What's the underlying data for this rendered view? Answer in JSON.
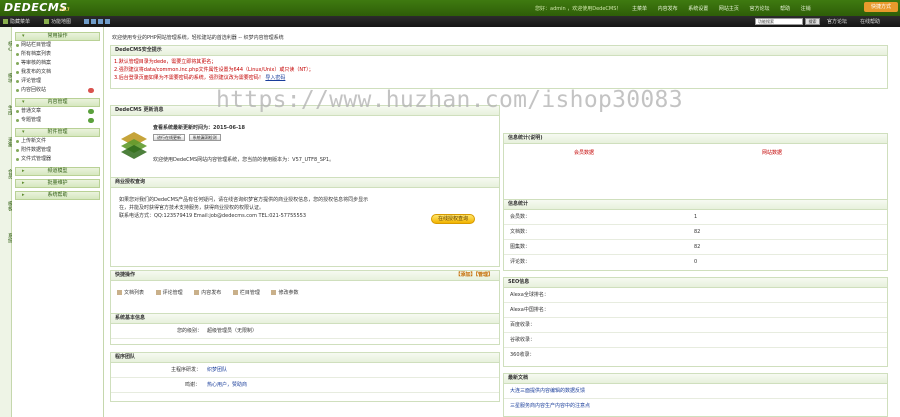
{
  "app": {
    "logo": "DEDECMS",
    "version": "v5.7"
  },
  "topnav": {
    "user_text": "您好：admin ，欢迎使用DedeCMS！",
    "links": [
      "主菜单",
      "内容发布",
      "系统设置",
      "网站主页",
      "官方论坛",
      "帮助",
      "注销"
    ],
    "quick_label": "快捷方式"
  },
  "bar2": {
    "items": [
      "隐藏菜单",
      "功能地图"
    ],
    "search_placeholder": "功能搜索",
    "search_btn": "搜索",
    "forum": "官方论坛",
    "online_help": "在线帮助"
  },
  "vtabs": [
    "核心",
    "模块",
    "生成",
    "采集",
    "会员",
    "模板",
    "系统"
  ],
  "sidebar": {
    "groups": [
      {
        "title": "常用操作",
        "items": [
          {
            "label": "网站栏目管理"
          },
          {
            "label": "所有档案列表"
          },
          {
            "label": "等审核的档案"
          },
          {
            "label": "我发布的文档"
          },
          {
            "label": "评论管理"
          },
          {
            "label": "内容回收站",
            "badge": "red"
          }
        ]
      },
      {
        "title": "内容管理",
        "items": [
          {
            "label": "普通文章",
            "badge": "green"
          },
          {
            "label": "专题管理",
            "badge": "green"
          }
        ]
      },
      {
        "title": "附件管理",
        "items": [
          {
            "label": "上传新文件"
          },
          {
            "label": "附件数据管理"
          },
          {
            "label": "文件式管理器"
          }
        ]
      },
      {
        "title": "频道模型",
        "items": []
      },
      {
        "title": "批量维护",
        "items": []
      },
      {
        "title": "系统帮助",
        "items": []
      }
    ]
  },
  "breadcrumb": "欢迎使用专业的PHP网站管理系统，轻松建站的首选利器 -- 织梦内容管理系统",
  "alert": {
    "title": "DedeCMS安全提示",
    "lines": [
      "1.默认管理目录为dede，需要立即将其更名；",
      "2.强烈建议将data/common.inc.php文件属性设置为644（Linux/Unix）或只读（NT）；",
      "3.后台登录页面如果为不需要密码的系统，强烈建议改为需要密码！"
    ],
    "link": "导入密码"
  },
  "update": {
    "title": "DedeCMS 更新消息",
    "latest": "查看系统最新更新时间为：2015-06-18",
    "btn1": "进行在线更新",
    "btn2": "系统漏洞检测",
    "desc": "欢迎使用DedeCMS网站内容管理系统，您当前的使用版本为：V57_UTF8_SP1。"
  },
  "biz": {
    "title": "商业授权查询",
    "line1": "如果您对我们的DedeCMS产品有任何疑问，请在线咨询织梦官方提供的商业授权信息，您的授权信息将同步显示",
    "line2": "在，并能及时获得官方技术支持服务，获得商业授权的权限认证。",
    "line3": "联系电话方式：QQ:123579419 Email:job@dedecms.com TEL:021-57755553",
    "btn": "在线授权查询"
  },
  "quick": {
    "title": "快捷操作",
    "edit": "【添加】【管理】",
    "items": [
      "文档列表",
      "评论管理",
      "内容发布",
      "栏目管理",
      "修改参数"
    ]
  },
  "sysinfo": {
    "title": "系统基本信息",
    "label": "您的级别：",
    "value": "超级管理员（无限制）"
  },
  "team": {
    "title": "程序团队",
    "rows": [
      {
        "k": "主程序研发：",
        "v": "织梦团队"
      },
      {
        "k": "鸣谢：",
        "v": "热心用户，赞助商"
      }
    ]
  },
  "msg": {
    "title": "信息统计(说明)",
    "cols": [
      "会员数据",
      "网站数据"
    ]
  },
  "stats": {
    "title": "信息统计",
    "rows": [
      {
        "k": "会员数：",
        "v": "1"
      },
      {
        "k": "文档数：",
        "v": "82"
      },
      {
        "k": "图集数：",
        "v": "82"
      },
      {
        "k": "评论数：",
        "v": "0"
      }
    ]
  },
  "seo": {
    "title": "SEO信息",
    "rows": [
      {
        "k": "Alexa全球排名：",
        "v": ""
      },
      {
        "k": "Alexa中国排名：",
        "v": ""
      },
      {
        "k": "百度收录：",
        "v": ""
      },
      {
        "k": "谷歌收录：",
        "v": ""
      },
      {
        "k": "360收录：",
        "v": ""
      }
    ]
  },
  "news": {
    "title": "最新文档",
    "items": [
      "大连三面提供内容编辑的数据反馈",
      "三星服务商内容生产内容中的注意点"
    ]
  },
  "watermark": "https://www.huzhan.com/ishop30083"
}
